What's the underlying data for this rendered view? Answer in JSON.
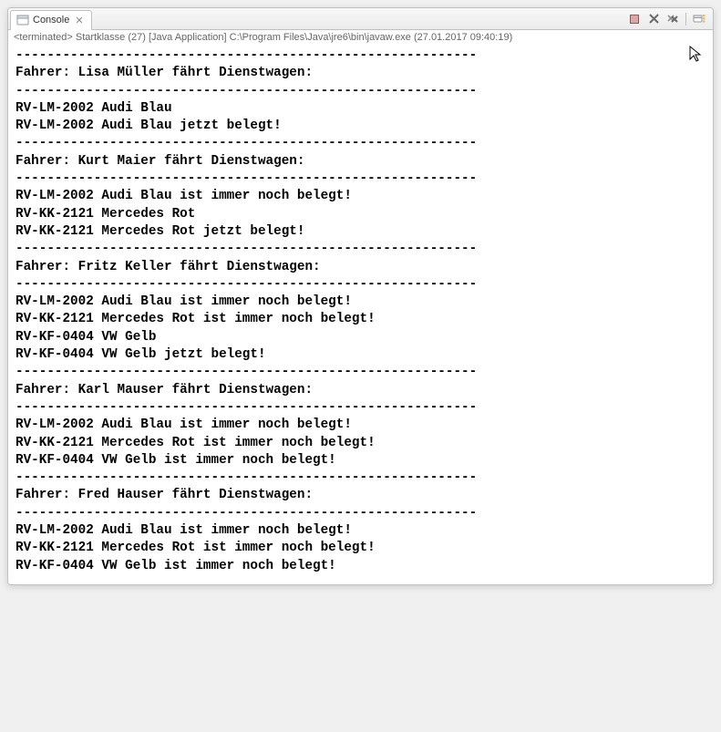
{
  "tab": {
    "label": "Console",
    "close_glyph": "✕"
  },
  "status": "<terminated> Startklasse (27) [Java Application] C:\\Program Files\\Java\\jre6\\bin\\javaw.exe (27.01.2017 09:40:19)",
  "output": "-----------------------------------------------------------\nFahrer: Lisa Müller fährt Dienstwagen:\n-----------------------------------------------------------\nRV-LM-2002 Audi Blau\nRV-LM-2002 Audi Blau jetzt belegt!\n-----------------------------------------------------------\nFahrer: Kurt Maier fährt Dienstwagen:\n-----------------------------------------------------------\nRV-LM-2002 Audi Blau ist immer noch belegt!\nRV-KK-2121 Mercedes Rot\nRV-KK-2121 Mercedes Rot jetzt belegt!\n-----------------------------------------------------------\nFahrer: Fritz Keller fährt Dienstwagen:\n-----------------------------------------------------------\nRV-LM-2002 Audi Blau ist immer noch belegt!\nRV-KK-2121 Mercedes Rot ist immer noch belegt!\nRV-KF-0404 VW Gelb\nRV-KF-0404 VW Gelb jetzt belegt!\n-----------------------------------------------------------\nFahrer: Karl Mauser fährt Dienstwagen:\n-----------------------------------------------------------\nRV-LM-2002 Audi Blau ist immer noch belegt!\nRV-KK-2121 Mercedes Rot ist immer noch belegt!\nRV-KF-0404 VW Gelb ist immer noch belegt!\n-----------------------------------------------------------\nFahrer: Fred Hauser fährt Dienstwagen:\n-----------------------------------------------------------\nRV-LM-2002 Audi Blau ist immer noch belegt!\nRV-KK-2121 Mercedes Rot ist immer noch belegt!\nRV-KF-0404 VW Gelb ist immer noch belegt!"
}
